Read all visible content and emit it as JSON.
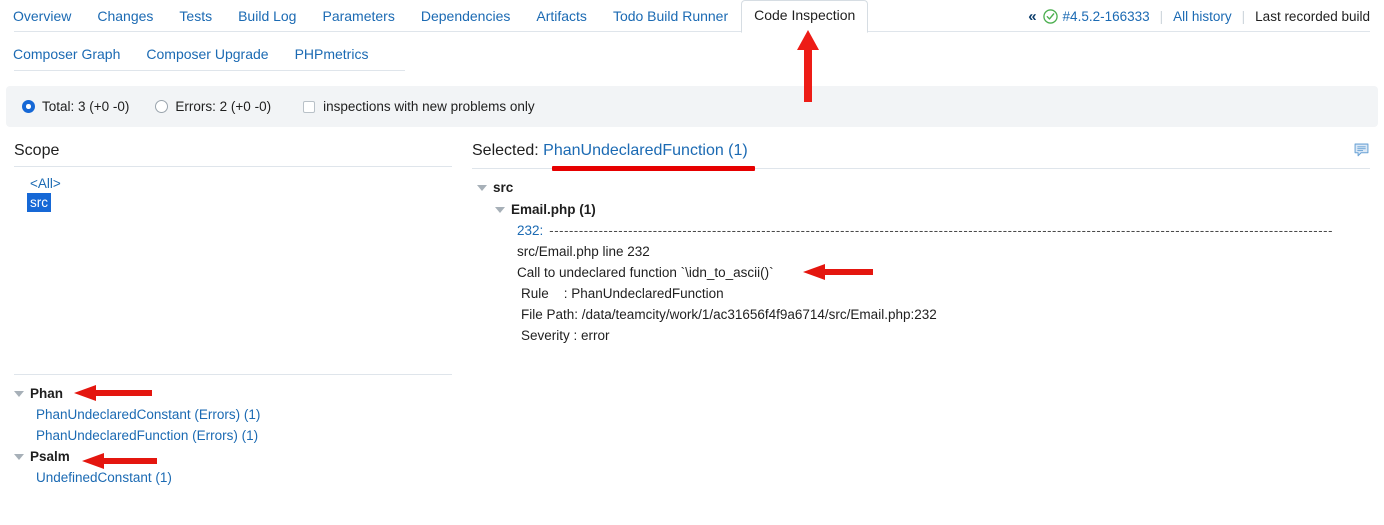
{
  "tabs_row1": [
    {
      "label": "Overview",
      "active": false
    },
    {
      "label": "Changes",
      "active": false
    },
    {
      "label": "Tests",
      "active": false
    },
    {
      "label": "Build Log",
      "active": false
    },
    {
      "label": "Parameters",
      "active": false
    },
    {
      "label": "Dependencies",
      "active": false
    },
    {
      "label": "Artifacts",
      "active": false
    },
    {
      "label": "Todo Build Runner",
      "active": false
    },
    {
      "label": "Code Inspection",
      "active": true
    }
  ],
  "tabs_row2": [
    {
      "label": "Composer Graph"
    },
    {
      "label": "Composer Upgrade"
    },
    {
      "label": "PHPmetrics"
    }
  ],
  "build_info": {
    "collapse_icon": "«",
    "status_icon": "green-check-circle-icon",
    "build_number": "#4.5.2-166333",
    "separator": "|",
    "all_history": "All history",
    "last_recorded": "Last recorded build"
  },
  "filter_bar": {
    "total_label": "Total: 3 (+0 -0)",
    "total_selected": true,
    "errors_label": "Errors: 2 (+0 -0)",
    "errors_selected": false,
    "new_problems_label": "inspections with new problems only",
    "new_problems_checked": false
  },
  "scope": {
    "heading": "Scope",
    "items": [
      {
        "label": "<All>",
        "selected": false
      },
      {
        "label": "src",
        "selected": true
      }
    ]
  },
  "rules": [
    {
      "name": "Phan",
      "expanded": true,
      "items": [
        {
          "label": "PhanUndeclaredConstant (Errors) (1)"
        },
        {
          "label": "PhanUndeclaredFunction (Errors) (1)"
        }
      ]
    },
    {
      "name": "Psalm",
      "expanded": true,
      "items": [
        {
          "label": "UndefinedConstant (1)"
        }
      ]
    }
  ],
  "detail": {
    "selected_prefix": "Selected:",
    "selected_name": "PhanUndeclaredFunction (1)",
    "comment_icon": "comment-bubble-icon",
    "tree": {
      "root": "src",
      "file": "Email.php (1)",
      "line_no": "232:",
      "dashes": "---------------------------------------------------------------------------------------------------------------------------------------------------------------",
      "location": "src/Email.php line 232",
      "message": "Call to undeclared function `\\idn_to_ascii()`",
      "rule": "Rule    : PhanUndeclaredFunction",
      "file_path": "File Path: /data/teamcity/work/1/ac31656f4f9a6714/src/Email.php:232",
      "severity": "Severity : error"
    }
  },
  "colors": {
    "link_blue": "#1b6ab3",
    "selection_blue": "#1668d6",
    "annotation_red": "#e60000",
    "status_green": "#4caf50",
    "filter_bar_bg": "#f2f4f6",
    "border_gray": "#dfe5eb"
  }
}
